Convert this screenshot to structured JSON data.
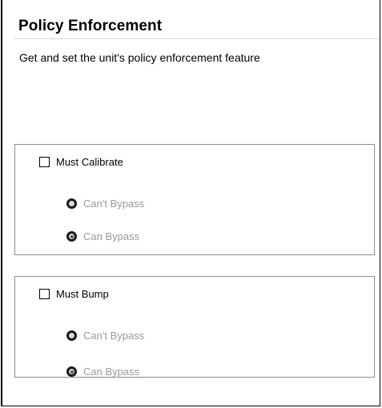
{
  "panel": {
    "title": "Policy Enforcement",
    "description": "Get and set the unit's policy enforcement feature"
  },
  "groups": [
    {
      "checkbox_label": "Must Calibrate",
      "checked": false,
      "options": [
        {
          "label": "Can't Bypass",
          "selected": false
        },
        {
          "label": "Can Bypass",
          "selected": true
        }
      ]
    },
    {
      "checkbox_label": "Must Bump",
      "checked": false,
      "options": [
        {
          "label": "Can't Bypass",
          "selected": false
        },
        {
          "label": "Can Bypass",
          "selected": true
        }
      ]
    }
  ]
}
